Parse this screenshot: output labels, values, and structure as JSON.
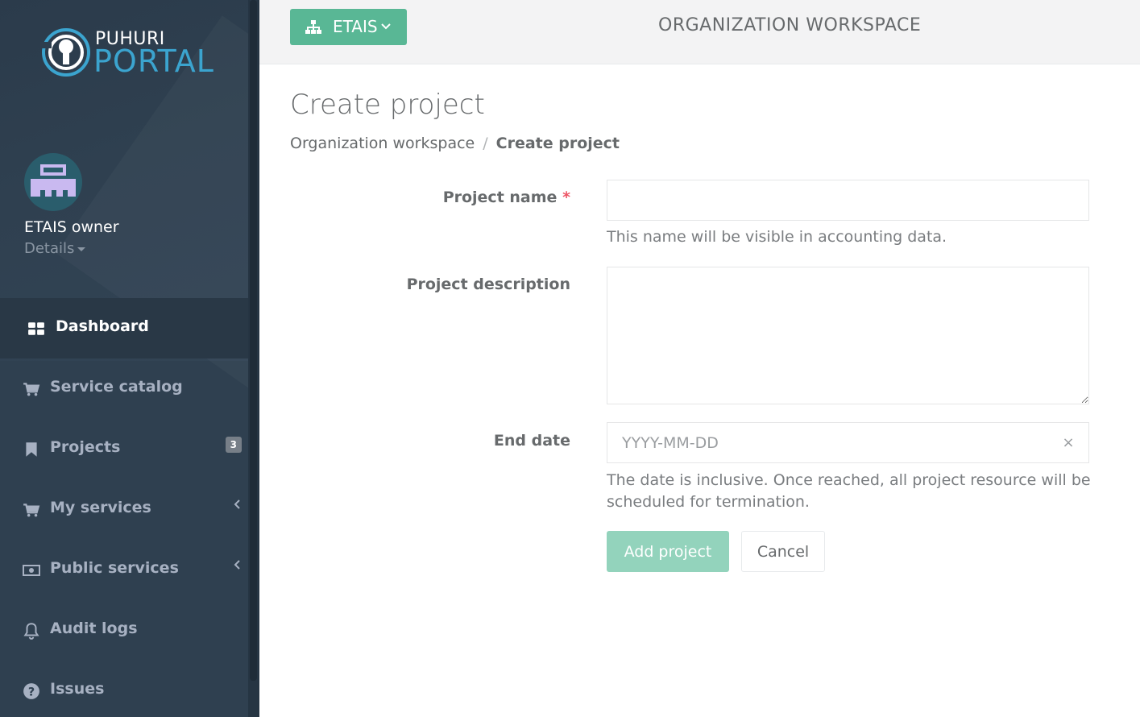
{
  "logo": {
    "top_text": "PUHURI",
    "bottom_text": "PORTAL"
  },
  "user": {
    "name": "ETAIS owner",
    "details_label": "Details"
  },
  "sidebar": {
    "items": [
      {
        "label": "Dashboard",
        "icon": "dashboard-icon"
      },
      {
        "label": "Service catalog",
        "icon": "cart-icon"
      },
      {
        "label": "Projects",
        "icon": "bookmark-icon",
        "badge": "3"
      },
      {
        "label": "My services",
        "icon": "cart-icon"
      },
      {
        "label": "Public services",
        "icon": "money-icon"
      },
      {
        "label": "Audit logs",
        "icon": "bell-icon"
      },
      {
        "label": "Issues",
        "icon": "question-circle-icon"
      }
    ]
  },
  "topbar": {
    "org_button_label": "ETAIS",
    "workspace_title": "ORGANIZATION WORKSPACE"
  },
  "page": {
    "title": "Create project",
    "breadcrumb": {
      "parent": "Organization workspace",
      "separator": "/",
      "current": "Create project"
    }
  },
  "form": {
    "project_name_label": "Project name",
    "project_name_required": "*",
    "project_name_value": "",
    "project_name_help": "This name will be visible in accounting data.",
    "project_description_label": "Project description",
    "project_description_value": "",
    "end_date_label": "End date",
    "end_date_placeholder": "YYYY-MM-DD",
    "end_date_clear": "×",
    "end_date_help_line1": "The date is inclusive. Once reached, all project resource will be",
    "end_date_help_line2": "scheduled for termination.",
    "submit_label": "Add project",
    "cancel_label": "Cancel"
  },
  "colors": {
    "sidebar_bg": "#2f4050",
    "accent_green": "#59b795",
    "disabled_green": "#93d3bc",
    "logo_blue": "#3ba4cf",
    "required_red": "#ed5565"
  }
}
